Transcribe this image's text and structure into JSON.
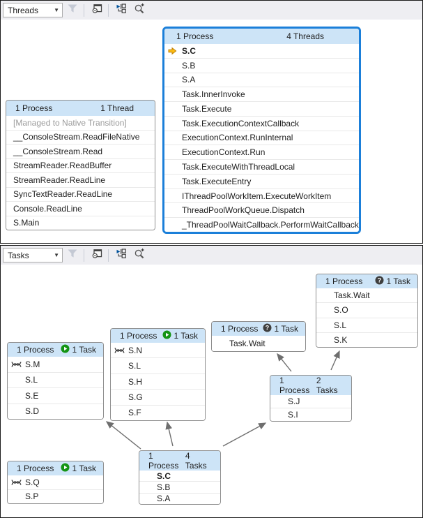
{
  "colors": {
    "selected_box_border": "#1b7fd9",
    "box_border": "#8f8f8f",
    "box_header_bg": "#cde4f7",
    "toolbar_bg": "#eeeef2",
    "arrow_line": "#6e6e6e",
    "current_arrow_yellow": "#fdbE14",
    "running_green": "#149414",
    "waiting_badge": "#3f3f3f",
    "muted_text": "#9b9b9b"
  },
  "threads_view": {
    "combo_value": "Threads",
    "toolbar_icons": [
      "filter-icon",
      "method-view-icon",
      "auto-scroll-icon",
      "zoom-control-icon"
    ],
    "boxes": [
      {
        "process": "1 Process",
        "count": "1 Thread",
        "selected": false,
        "frames": [
          {
            "text": "[Managed to Native Transition]",
            "muted": true
          },
          {
            "text": "__ConsoleStream.ReadFileNative"
          },
          {
            "text": "__ConsoleStream.Read"
          },
          {
            "text": "StreamReader.ReadBuffer"
          },
          {
            "text": "StreamReader.ReadLine"
          },
          {
            "text": "SyncTextReader.ReadLine"
          },
          {
            "text": "Console.ReadLine"
          },
          {
            "text": "S.Main"
          }
        ]
      },
      {
        "process": "1 Process",
        "count": "4 Threads",
        "selected": true,
        "frames": [
          {
            "text": "S.C",
            "bold": true,
            "icon": "current-statement-arrow"
          },
          {
            "text": "S.B"
          },
          {
            "text": "S.A"
          },
          {
            "text": "Task.InnerInvoke"
          },
          {
            "text": "Task.Execute"
          },
          {
            "text": "Task.ExecutionContextCallback"
          },
          {
            "text": "ExecutionContext.RunInternal"
          },
          {
            "text": "ExecutionContext.Run"
          },
          {
            "text": "Task.ExecuteWithThreadLocal"
          },
          {
            "text": "Task.ExecuteEntry"
          },
          {
            "text": "IThreadPoolWorkItem.ExecuteWorkItem"
          },
          {
            "text": "ThreadPoolWorkQueue.Dispatch"
          },
          {
            "text": "_ThreadPoolWaitCallback.PerformWaitCallback"
          }
        ]
      }
    ]
  },
  "tasks_view": {
    "combo_value": "Tasks",
    "toolbar_icons": [
      "filter-icon",
      "method-view-icon",
      "auto-scroll-icon",
      "zoom-control-icon"
    ],
    "boxes": [
      {
        "process": "1 Process",
        "count": "1 Task",
        "status_icon": "waiting",
        "frames": [
          {
            "text": "Task.Wait"
          },
          {
            "text": "S.O"
          },
          {
            "text": "S.L"
          },
          {
            "text": "S.K"
          }
        ]
      },
      {
        "process": "1 Process",
        "count": "1 Task",
        "status_icon": "waiting",
        "frames": [
          {
            "text": "Task.Wait"
          }
        ]
      },
      {
        "process": "1 Process",
        "count": "1 Task",
        "status_icon": "running",
        "frames": [
          {
            "text": "S.N",
            "icon": "threads"
          },
          {
            "text": "S.L"
          },
          {
            "text": "S.H"
          },
          {
            "text": "S.G"
          },
          {
            "text": "S.F"
          }
        ]
      },
      {
        "process": "1 Process",
        "count": "1 Task",
        "status_icon": "running",
        "frames": [
          {
            "text": "S.M",
            "icon": "threads"
          },
          {
            "text": "S.L"
          },
          {
            "text": "S.E"
          },
          {
            "text": "S.D"
          }
        ]
      },
      {
        "process": "1 Process",
        "count": "2 Tasks",
        "frames": [
          {
            "text": "S.J"
          },
          {
            "text": "S.I"
          }
        ]
      },
      {
        "process": "1 Process",
        "count": "4 Tasks",
        "frames": [
          {
            "text": "S.C",
            "bold": true
          },
          {
            "text": "S.B"
          },
          {
            "text": "S.A"
          }
        ]
      },
      {
        "process": "1 Process",
        "count": "1 Task",
        "status_icon": "running",
        "frames": [
          {
            "text": "S.Q",
            "icon": "threads"
          },
          {
            "text": "S.P"
          }
        ]
      }
    ]
  }
}
